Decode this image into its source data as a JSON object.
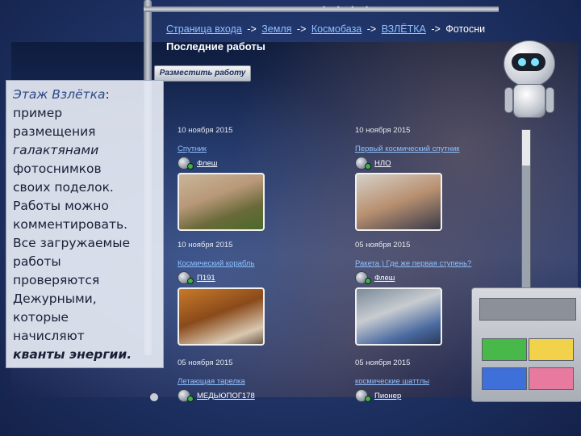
{
  "breadcrumb": {
    "items": [
      "Страница входа",
      "Земля",
      "Космобаза",
      "ВЗЛЁТКА",
      "Фотосни"
    ],
    "separator": "->"
  },
  "page_title": "Последние работы",
  "post_button_label": "Разместить работу",
  "works": [
    {
      "date": "10 ноября 2015",
      "title": "Спутник",
      "author": "Флеш"
    },
    {
      "date": "10 ноября 2015",
      "title": "Первый космический спутник",
      "author": "НЛО"
    },
    {
      "date": "10 ноября 2015",
      "title": "Космический корабль",
      "author": "П191"
    },
    {
      "date": "05 ноября 2015",
      "title": "Ракета ) Где же первая ступень?",
      "author": "Флеш"
    },
    {
      "date": "05 ноября 2015",
      "title": "Летающая тарелка",
      "author": "МЕДЬЮПОГ178"
    },
    {
      "date": "05 ноября 2015",
      "title": "космические шаттлы",
      "author": "Пионер"
    }
  ],
  "description": {
    "heading": "Этаж Взлётка",
    "heading_colon": ":",
    "line1": "пример",
    "line2": "размещения",
    "line3_italic": "галактянами",
    "line4": "фотоснимков",
    "line5": "своих поделок.",
    "line6": "Работы можно",
    "line7": "комментировать.",
    "line8": "Все загружаемые",
    "line9": "работы",
    "line10": "проверяются",
    "line11": "Дежурными,",
    "line12": "которые",
    "line13": "начисляют",
    "line14_bold": "кванты энергии."
  },
  "pipe_dots": "• • • •",
  "icons": {
    "robot": "robot-mascot-icon",
    "avatar": "user-avatar-icon"
  },
  "colors": {
    "link": "#8ec0ff",
    "heading_accent": "#2c4a86",
    "control_green": "#49b84a",
    "control_yellow": "#f1d24a",
    "control_blue": "#3f6fd8",
    "control_pink": "#e87aa0"
  }
}
